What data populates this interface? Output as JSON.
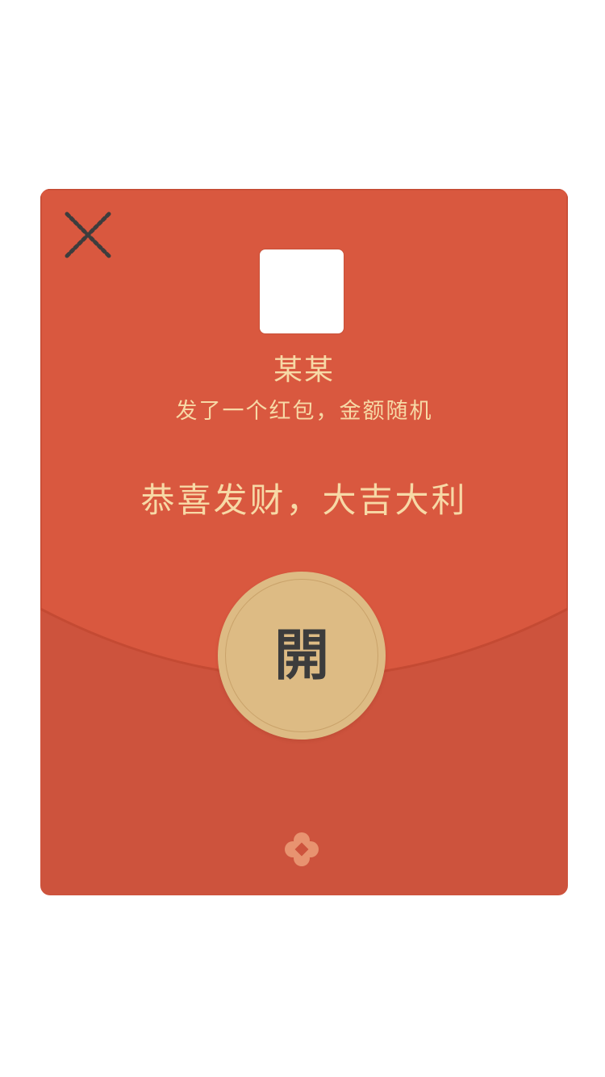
{
  "sender": {
    "name": "某某",
    "subtitle": "发了一个红包，金额随机"
  },
  "greeting": "恭喜发财，大吉大利",
  "open_button": {
    "label": "開"
  },
  "icons": {
    "close": "close-icon",
    "footer": "flower-icon"
  },
  "colors": {
    "envelope_top": "#d9583f",
    "envelope_bottom": "#cd533d",
    "text_gold": "#f7d9a6",
    "button_gold": "#ddbb84",
    "button_text": "#3c3c3c",
    "close_icon": "#3d3d3d",
    "flower": "#e89370"
  }
}
